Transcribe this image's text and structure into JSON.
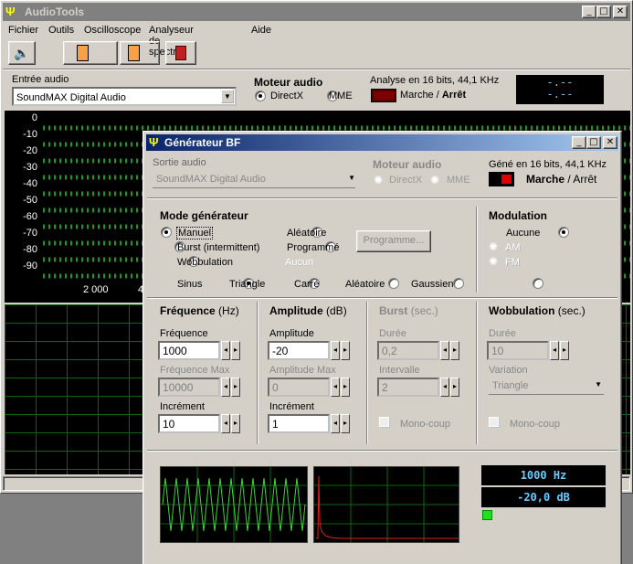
{
  "main": {
    "title": "AudioTools",
    "menu": [
      "Fichier",
      "Outils",
      "Oscilloscope",
      "Analyseur de spectre",
      "Aide"
    ],
    "input_label": "Entrée audio",
    "input_value": "SoundMAX Digital Audio",
    "engine_label": "Moteur audio",
    "engine_directx": "DirectX",
    "engine_mme": "MME",
    "analysis": "Analyse en 16 bits, 44,1 KHz",
    "run_on": "Marche",
    "run_sep": " / ",
    "run_off": "Arrêt",
    "lcd_1": "-.--",
    "lcd_2": "-.--",
    "y_ticks": [
      "0",
      "-10",
      "-20",
      "-30",
      "-40",
      "-50",
      "-60",
      "-70",
      "-80",
      "-90"
    ],
    "x_ticks": [
      "2 000",
      "4"
    ]
  },
  "gen": {
    "title": "Générateur BF",
    "output_label": "Sortie audio",
    "output_value": "SoundMAX Digital Audio",
    "engine_label": "Moteur audio",
    "engine_directx": "DirectX",
    "engine_mme": "MME",
    "gen_info": "Géné en 16 bits, 44,1 KHz",
    "run_on": "Marche",
    "run_sep": " / ",
    "run_off": "Arrêt",
    "mode_title": "Mode générateur",
    "mode_manuel": "Manuel",
    "mode_burst": "Burst (intermittent)",
    "mode_wobb": "Wobbulation",
    "mode_aleat": "Aléatoire",
    "mode_prog": "Programmé",
    "mode_aucun": "Aucun",
    "prog_button": "Programme...",
    "mod_title": "Modulation",
    "mod_aucune": "Aucune",
    "mod_am": "AM",
    "mod_fm": "FM",
    "waves": [
      "Sinus",
      "Triangle",
      "Carré",
      "Aléatoire",
      "Gaussien"
    ],
    "freq_title": "Fréquence",
    "freq_unit": "(Hz)",
    "freq_label": "Fréquence",
    "freq_value": "1000",
    "freqmax_label": "Fréquence Max",
    "freqmax_value": "10000",
    "freqinc_label": "Incrément",
    "freqinc_value": "10",
    "amp_title": "Amplitude",
    "amp_unit": "(dB)",
    "amp_label": "Amplitude",
    "amp_value": "-20",
    "ampmax_label": "Amplitude Max",
    "ampmax_value": "0",
    "ampinc_label": "Incrément",
    "ampinc_value": "1",
    "burst_title": "Burst",
    "burst_unit": "(sec.)",
    "burst_dur_label": "Durée",
    "burst_dur_value": "0,2",
    "burst_int_label": "Intervalle",
    "burst_int_value": "2",
    "burst_mono": "Mono-coup",
    "wobb_title": "Wobbulation",
    "wobb_unit": "(sec.)",
    "wobb_dur_label": "Durée",
    "wobb_dur_value": "10",
    "wobb_var_label": "Variation",
    "wobb_var_value": "Triangle",
    "wobb_mono": "Mono-coup",
    "lcd_freq": "1000 Hz",
    "lcd_amp": "-20,0 dB"
  }
}
